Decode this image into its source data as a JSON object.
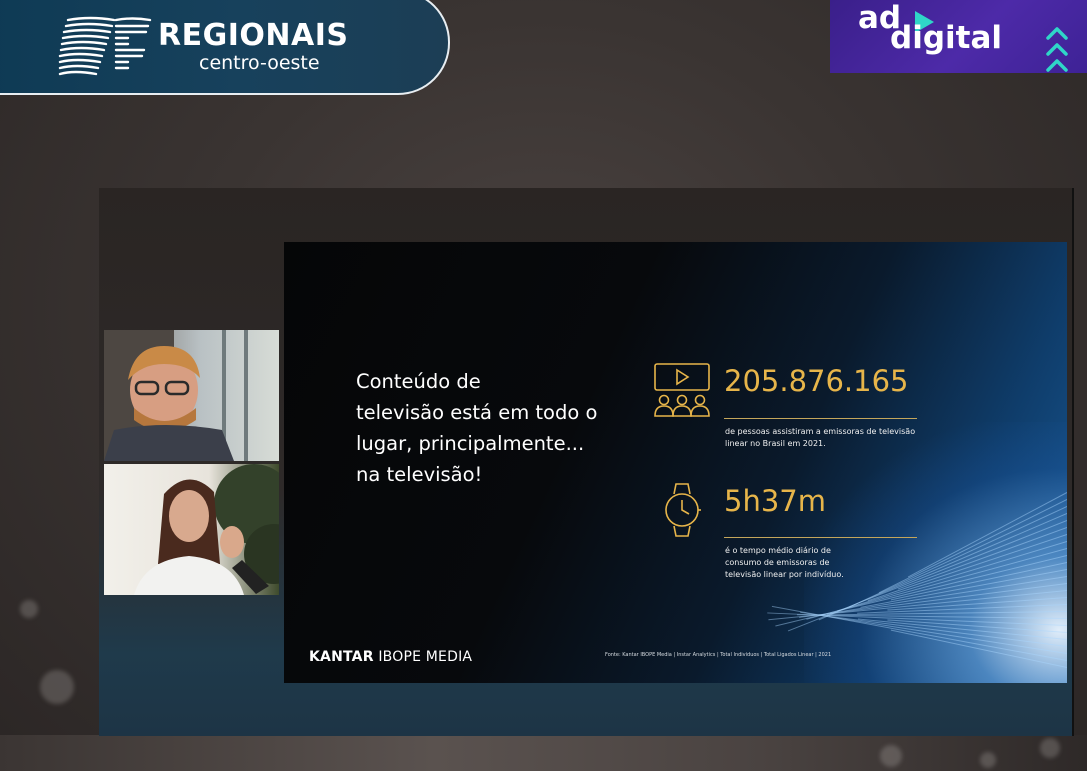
{
  "header": {
    "logo_title": "REGIONAIS",
    "logo_subtitle": "centro-oeste",
    "logo_icon": "newspaper-lines-icon"
  },
  "brand": {
    "top": "ad",
    "bottom": "digital",
    "play_icon": "play-triangle-icon",
    "chevron_icon": "triple-chevron-up-icon"
  },
  "slide": {
    "headline": [
      "Conteúdo de",
      "televisão está em todo o",
      "lugar, principalmente...",
      "na televisão!"
    ],
    "stats": [
      {
        "icon": "video-audience-icon",
        "value": "205.876.165",
        "description": [
          "de pessoas assistiram a emissoras de televisão",
          "linear no Brasil em 2021."
        ]
      },
      {
        "icon": "wristwatch-icon",
        "value": "5h37m",
        "description": [
          "é o tempo médio diário de",
          "consumo de emissoras de",
          "televisão linear por indivíduo."
        ]
      }
    ],
    "logo": {
      "strong": "KANTAR",
      "light": " IBOPE MEDIA"
    },
    "source": "Fonte: Kantar IBOPE Media | Instar Analytics | Total Indivíduos | Total Ligados Linear | 2021"
  },
  "colors": {
    "accent_gold": "#e7b54a",
    "header_blue": "#0e3a54",
    "brand_purple": "#4d2aa8",
    "brand_teal": "#2fd6c8"
  }
}
